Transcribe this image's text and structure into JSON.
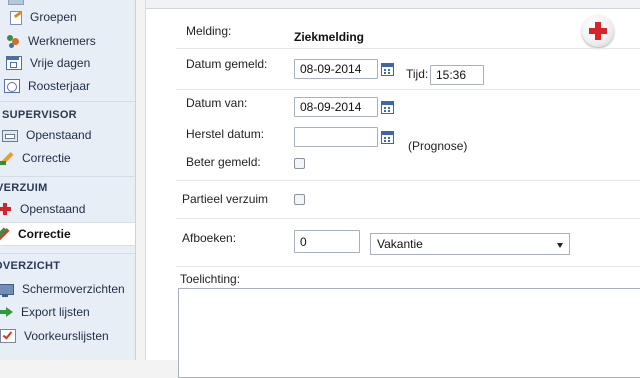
{
  "sidebar": {
    "items_top": [
      {
        "label": "Groepen",
        "icon": "groups-icon"
      },
      {
        "label": "Werknemers",
        "icon": "employees-icon"
      },
      {
        "label": "Vrije dagen",
        "icon": "calendar-icon"
      },
      {
        "label": "Roosterjaar",
        "icon": "schedule-year-icon"
      }
    ],
    "sections": [
      {
        "title": "SUPERVISOR",
        "items": [
          {
            "label": "Openstaand",
            "icon": "inbox-icon"
          },
          {
            "label": "Correctie",
            "icon": "pencil-icon"
          }
        ]
      },
      {
        "title": "VERZUIM",
        "items": [
          {
            "label": "Openstaand",
            "icon": "red-cross-icon"
          },
          {
            "label": "Correctie",
            "icon": "edit-icon",
            "active": true
          }
        ]
      },
      {
        "title": "OVERZICHT",
        "items": [
          {
            "label": "Schermoverzichten",
            "icon": "monitor-icon"
          },
          {
            "label": "Export lijsten",
            "icon": "export-arrow-icon"
          },
          {
            "label": "Voorkeurslijsten",
            "icon": "checklist-icon"
          }
        ]
      }
    ]
  },
  "form": {
    "melding_label": "Melding:",
    "melding_value": "Ziekmelding",
    "datum_gemeld_label": "Datum gemeld:",
    "datum_gemeld_value": "08-09-2014",
    "tijd_label": "Tijd:",
    "tijd_value": "15:36",
    "datum_van_label": "Datum van:",
    "datum_van_value": "08-09-2014",
    "herstel_datum_label": "Herstel datum:",
    "herstel_datum_value": "",
    "prognose_label": "(Prognose)",
    "beter_gemeld_label": "Beter gemeld:",
    "beter_gemeld_checked": false,
    "partieel_verzuim_label": "Partieel verzuim",
    "partieel_verzuim_checked": false,
    "afboeken_label": "Afboeken:",
    "afboeken_value": "0",
    "afboeken_type": "Vakantie",
    "toelichting_label": "Toelichting:",
    "toelichting_value": ""
  },
  "colors": {
    "sidebar_bg": "#e7eef6",
    "accent_red": "#d8232a",
    "calendar_blue": "#3e66a8"
  }
}
